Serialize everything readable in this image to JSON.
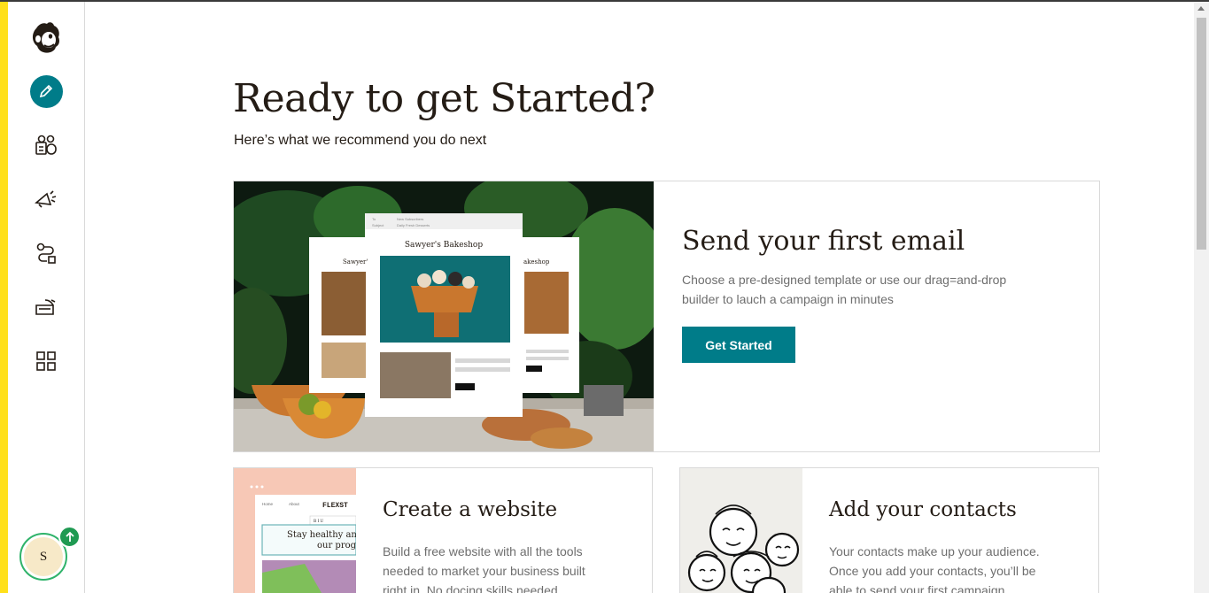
{
  "page": {
    "heading": "Ready to get Started?",
    "subheading": "Here’s what we recommend you do next"
  },
  "sidebar": {
    "items": [
      {
        "name": "mailchimp-logo-icon"
      },
      {
        "name": "create-pencil-icon"
      },
      {
        "name": "audience-icon"
      },
      {
        "name": "campaigns-icon"
      },
      {
        "name": "automations-icon"
      },
      {
        "name": "website-icon"
      },
      {
        "name": "dashboard-grid-icon"
      }
    ],
    "avatar_initial": "S",
    "upgrade_badge_icon": "arrow-up-icon"
  },
  "cards": {
    "email": {
      "title": "Send your first email",
      "description": "Choose a pre-designed template or use our drag=and-drop builder to lauch a campaign in minutes",
      "cta_label": "Get Started",
      "illustration": {
        "center_title": "Sawyer's Bakeshop",
        "left_title": "Sawyer'",
        "right_title": "akeshop",
        "to_label": "To",
        "subject_label": "Subject",
        "to_value": "New Subscribers",
        "subject_value": "Daily Fresh Desserts"
      }
    },
    "website": {
      "title": "Create a website",
      "description": "Build a free website with all the tools needed to market your business built right in. No docing skills needed.",
      "thumb_brand": "FLEXST",
      "thumb_nav": [
        "Home",
        "About"
      ],
      "thumb_toolbar": "B I U",
      "thumb_text_line1": "Stay healthy and",
      "thumb_text_line2": "our progr"
    },
    "contacts": {
      "title": "Add your contacts",
      "description": "Your contacts make up your audience. Once you add your contacts, you’ll be able to send your first campaign."
    }
  },
  "colors": {
    "brand_yellow": "#ffe01b",
    "accent_teal": "#007c89",
    "badge_green": "#1f9a52"
  }
}
